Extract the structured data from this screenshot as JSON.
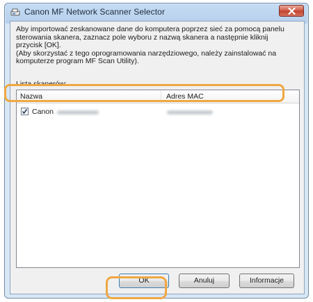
{
  "window": {
    "title": "Canon MF Network Scanner Selector",
    "app_icon": "scanner-app-icon",
    "close_icon": "close-icon"
  },
  "description": {
    "line1": "Aby importować zeskanowane dane do komputera poprzez sieć za pomocą panelu",
    "line2": "sterowania skanera, zaznacz pole wyboru z nazwą skanera a następnie kliknij",
    "line3": "przycisk [OK].",
    "line4": "(Aby skorzystać z tego oprogramowania narzędziowego, należy zainstalować na",
    "line5": "komputerze program MF Scan Utility)."
  },
  "scanner_list": {
    "label": "Lista skanerów:",
    "columns": {
      "name": "Nazwa",
      "mac": "Adres MAC"
    },
    "rows": [
      {
        "name": "Canon",
        "checked": true
      }
    ]
  },
  "buttons": {
    "ok": "OK",
    "cancel": "Anuluj",
    "info": "Informacje"
  },
  "colors": {
    "highlight": "#f0a742",
    "close_button": "#c1412c"
  }
}
